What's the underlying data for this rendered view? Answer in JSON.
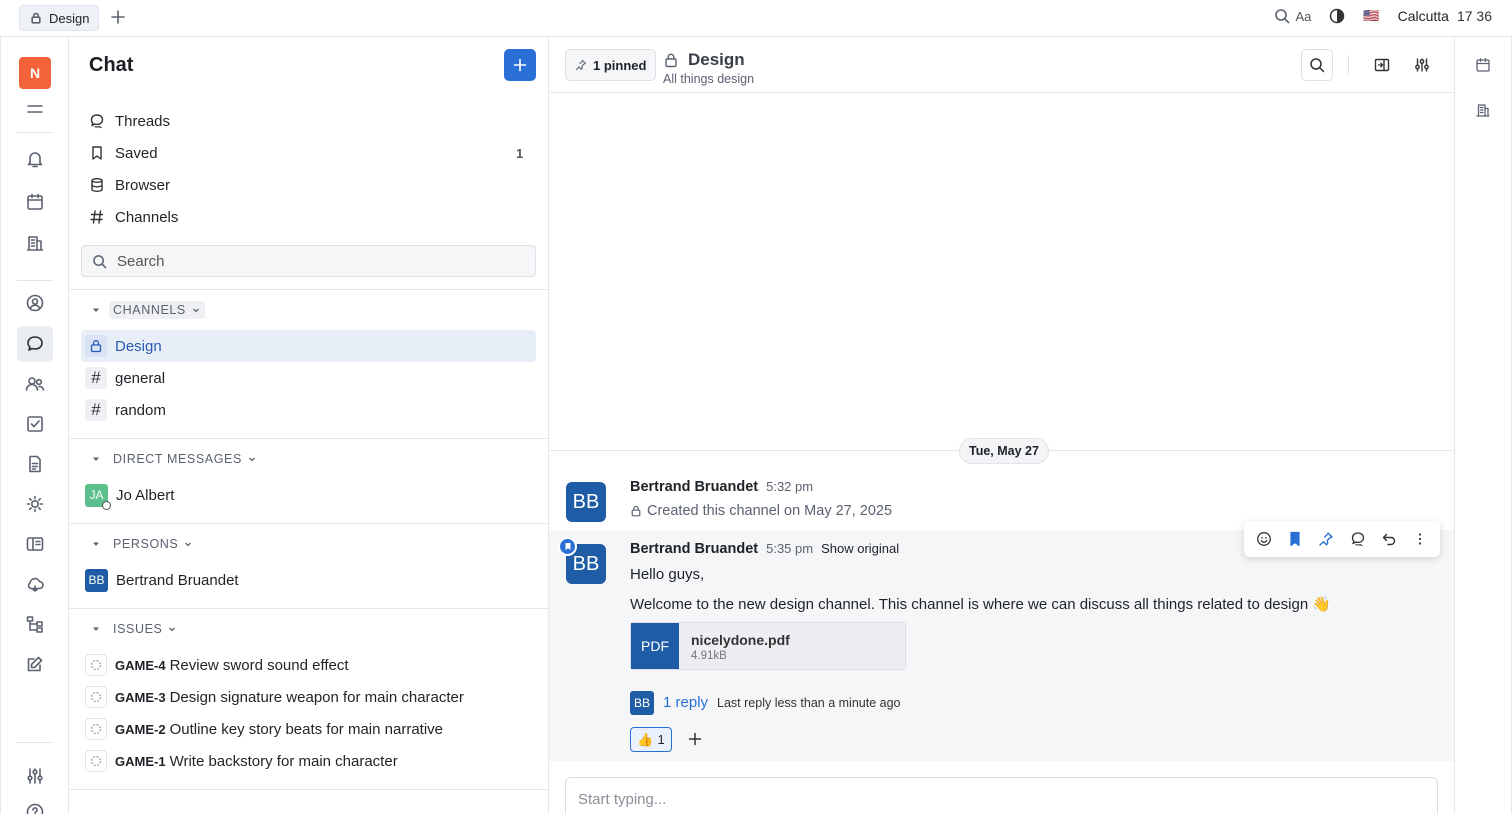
{
  "topbar": {
    "tab_label": "Design",
    "font_label": "Aa",
    "flag": "🇺🇸",
    "location": "Calcutta",
    "time": "17 36"
  },
  "rail": {
    "workspace_initial": "N",
    "accent": "#f4623a"
  },
  "sidebar": {
    "title": "Chat",
    "nav": [
      {
        "label": "Threads",
        "icon": "threads-icon"
      },
      {
        "label": "Saved",
        "icon": "bookmark-icon",
        "count": "1"
      },
      {
        "label": "Browser",
        "icon": "database-icon"
      },
      {
        "label": "Channels",
        "icon": "hashtag-icon"
      }
    ],
    "search_placeholder": "Search",
    "channels_header": "CHANNELS",
    "channels": [
      {
        "name": "Design",
        "icon": "lock-icon",
        "active": true
      },
      {
        "name": "general",
        "icon": "hash"
      },
      {
        "name": "random",
        "icon": "hash"
      }
    ],
    "dm_header": "DIRECT MESSAGES",
    "dms": [
      {
        "initials": "JA",
        "name": "Jo Albert",
        "color": "#5cc08d"
      }
    ],
    "persons_header": "PERSONS",
    "persons": [
      {
        "initials": "BB",
        "name": "Bertrand Bruandet",
        "color": "#1f5ca6"
      }
    ],
    "issues_header": "ISSUES",
    "issues": [
      {
        "code": "GAME-4",
        "title": "Review sword sound effect"
      },
      {
        "code": "GAME-3",
        "title": "Design signature weapon for main character"
      },
      {
        "code": "GAME-2",
        "title": "Outline key story beats for main narrative"
      },
      {
        "code": "GAME-1",
        "title": "Write backstory for main character"
      }
    ]
  },
  "chat": {
    "pinned_label": "1 pinned",
    "channel_name": "Design",
    "channel_desc": "All things design",
    "date_divider": "Tue, May 27",
    "messages": [
      {
        "initials": "BB",
        "author": "Bertrand Bruandet",
        "time": "5:32 pm",
        "system_text": "Created this channel on May 27, 2025"
      },
      {
        "initials": "BB",
        "author": "Bertrand Bruandet",
        "time": "5:35 pm",
        "show_original": "Show original",
        "lines": [
          "Hello guys,",
          "Welcome to the new design channel. This channel is where we can discuss all things related to design 👋"
        ],
        "attachment": {
          "type": "PDF",
          "name": "nicelydone.pdf",
          "size": "4.91kB"
        },
        "reply_initials": "BB",
        "reply_count": "1 reply",
        "reply_meta": "Last reply less than a minute ago",
        "reaction_emoji": "👍",
        "reaction_count": "1"
      }
    ],
    "composer_placeholder": "Start typing...",
    "accent": "#2a6fd6"
  }
}
